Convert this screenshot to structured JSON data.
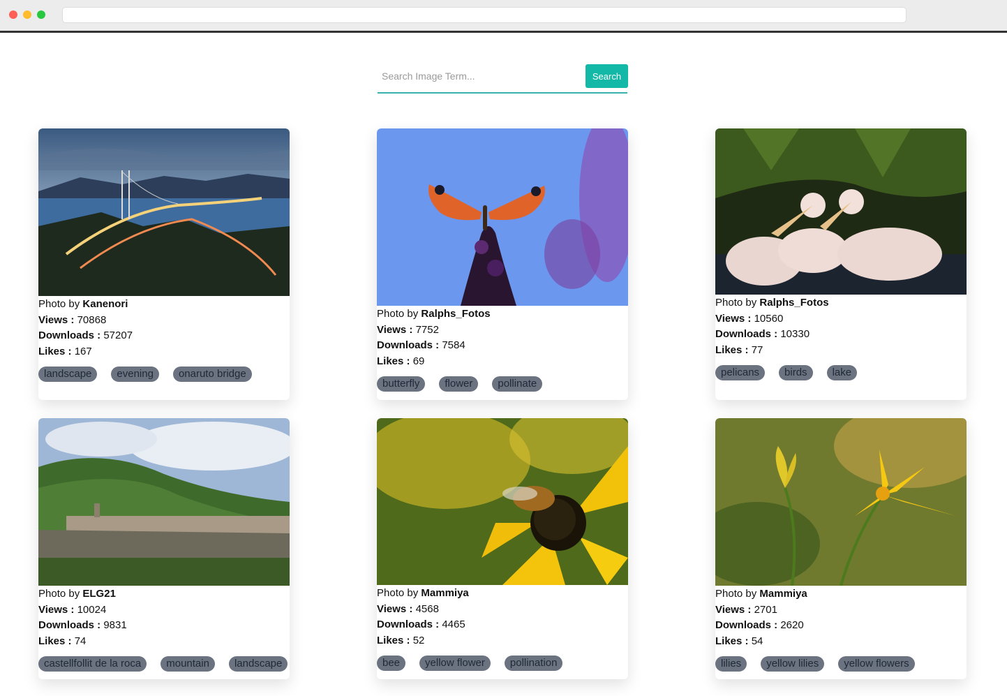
{
  "search": {
    "placeholder": "Search Image Term...",
    "button_label": "Search"
  },
  "labels": {
    "photo_by": "Photo by",
    "views": "Views :",
    "downloads": "Downloads :",
    "likes": "Likes :"
  },
  "cards": [
    {
      "author": "Kanenori",
      "views": "70868",
      "downloads": "57207",
      "likes": "167",
      "tags": [
        "landscape",
        "evening",
        "onaruto bridge"
      ]
    },
    {
      "author": "Ralphs_Fotos",
      "views": "7752",
      "downloads": "7584",
      "likes": "69",
      "tags": [
        "butterfly",
        "flower",
        "pollinate"
      ]
    },
    {
      "author": "Ralphs_Fotos",
      "views": "10560",
      "downloads": "10330",
      "likes": "77",
      "tags": [
        "pelicans",
        "birds",
        "lake"
      ]
    },
    {
      "author": "ELG21",
      "views": "10024",
      "downloads": "9831",
      "likes": "74",
      "tags": [
        "castellfollit de la roca",
        "mountain",
        "landscape"
      ]
    },
    {
      "author": "Mammiya",
      "views": "4568",
      "downloads": "4465",
      "likes": "52",
      "tags": [
        "bee",
        "yellow flower",
        "pollination"
      ]
    },
    {
      "author": "Mammiya",
      "views": "2701",
      "downloads": "2620",
      "likes": "54",
      "tags": [
        "lilies",
        "yellow lilies",
        "yellow flowers"
      ]
    }
  ]
}
